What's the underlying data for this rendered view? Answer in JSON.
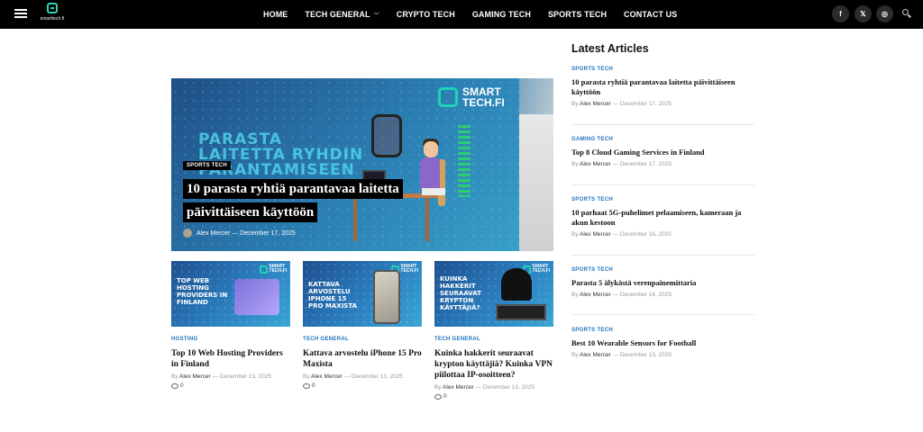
{
  "header": {
    "logo_text": "smarttech.fi",
    "nav": [
      {
        "label": "HOME"
      },
      {
        "label": "TECH GENERAL",
        "has_dropdown": true
      },
      {
        "label": "CRYPTO TECH"
      },
      {
        "label": "GAMING TECH"
      },
      {
        "label": "SPORTS TECH"
      },
      {
        "label": "CONTACT US"
      }
    ],
    "social": [
      {
        "icon": "facebook-icon",
        "glyph": "f"
      },
      {
        "icon": "x-icon",
        "glyph": "𝕏"
      },
      {
        "icon": "instagram-icon",
        "glyph": "◎"
      }
    ]
  },
  "featured": {
    "image_text_lines": [
      "PARASTA",
      "LAITETTA RYHDIN",
      "PARANTAMISEEN"
    ],
    "brand": [
      "SMART",
      "TECH.FI"
    ],
    "category": "SPORTS TECH",
    "title": "10 parasta ryhtiä parantavaa laitetta päivittäiseen käyttöön",
    "author": "Alex Mercer",
    "separator": "—",
    "date": "December 17, 2025"
  },
  "cards": [
    {
      "thumb_text": "TOP WEB HOSTING PROVIDERS IN FINLAND",
      "category": "HOSTING",
      "title": "Top 10 Web Hosting Providers in Finland",
      "by": "By",
      "author": "Alex Mercer",
      "date": "December 13, 2025",
      "comments": "0"
    },
    {
      "thumb_text": "KATTAVA ARVOSTELU IPHONE 15 PRO MAXISTA",
      "category": "TECH GENERAL",
      "title": "Kattava arvostelu iPhone 15 Pro Maxista",
      "by": "By",
      "author": "Alex Mercer",
      "date": "December 13, 2025",
      "comments": "0"
    },
    {
      "thumb_text": "KUINKA HAKKERIT SEURAAVAT KRYPTON KÄYTTÄJIÄ?",
      "category": "TECH GENERAL",
      "title": "Kuinka hakkerit seuraavat krypton käyttäjiä? Kuinka VPN piilottaa IP-osoitteen?",
      "by": "By",
      "author": "Alex Mercer",
      "date": "December 13, 2025",
      "comments": "0"
    }
  ],
  "sidebar": {
    "title": "Latest Articles",
    "items": [
      {
        "category": "SPORTS TECH",
        "title": "10 parasta ryhtiä parantavaa laitetta päivittäiseen käyttöön",
        "by": "By",
        "author": "Alex Mercer",
        "date": "December 17, 2025"
      },
      {
        "category": "GAMING TECH",
        "title": "Top 8 Cloud Gaming Services in Finland",
        "by": "By",
        "author": "Alex Mercer",
        "date": "December 17, 2025"
      },
      {
        "category": "SPORTS TECH",
        "title": "10 parhaat 5G-puhelimet pelaamiseen, kameraan ja akun kestoon",
        "by": "By",
        "author": "Alex Mercer",
        "date": "December 16, 2025"
      },
      {
        "category": "SPORTS TECH",
        "title": "Parasta 5 älykästä verenpainemittaria",
        "by": "By",
        "author": "Alex Mercer",
        "date": "December 14, 2025"
      },
      {
        "category": "SPORTS TECH",
        "title": "Best 10 Wearable Sensors for Football",
        "by": "By",
        "author": "Alex Mercer",
        "date": "December 13, 2025"
      }
    ]
  },
  "colors": {
    "accent": "#1e73be",
    "brand": "#1fd3b3",
    "topbar": "#000000"
  }
}
